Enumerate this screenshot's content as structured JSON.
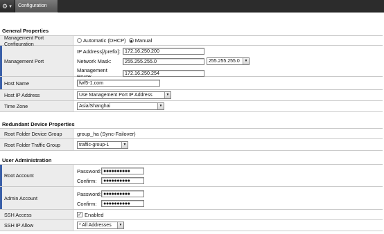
{
  "toolbar": {
    "config_tab_label": "Configuration"
  },
  "general": {
    "title": "General Properties",
    "mgmt_port_config": {
      "label": "Management Port Configuration",
      "auto_label": "Automatic (DHCP)",
      "manual_label": "Manual",
      "selected": "Manual"
    },
    "mgmt_port": {
      "label": "Management Port",
      "ip_label": "IP Address[/prefix]:",
      "ip_value": "172.16.250.200",
      "mask_label": "Network Mask:",
      "mask_value": "255.255.255.0",
      "mask_select": "255.255.255.0",
      "route_label": "Management Route:",
      "route_value": "172.16.250.254"
    },
    "host_name": {
      "label": "Host Name",
      "value": "fwf5-1.com"
    },
    "host_ip": {
      "label": "Host IP Address",
      "value": "Use Management Port IP Address"
    },
    "time_zone": {
      "label": "Time Zone",
      "value": "Asia/Shanghai"
    }
  },
  "redundant": {
    "title": "Redundant Device Properties",
    "device_group": {
      "label": "Root Folder Device Group",
      "value": "group_ha (Sync-Failover)"
    },
    "traffic_group": {
      "label": "Root Folder Traffic Group",
      "value": "traffic-group-1"
    }
  },
  "users": {
    "title": "User Administration",
    "root": {
      "label": "Root Account",
      "password_label": "Password:",
      "password_value": "●●●●●●●●●●",
      "confirm_label": "Confirm:",
      "confirm_value": "●●●●●●●●●●"
    },
    "admin": {
      "label": "Admin Account",
      "password_label": "Password:",
      "password_value": "●●●●●●●●●●",
      "confirm_label": "Confirm:",
      "confirm_value": "●●●●●●●●●●"
    },
    "ssh_access": {
      "label": "SSH Access",
      "value": "Enabled",
      "checked": true
    },
    "ssh_ip_allow": {
      "label": "SSH IP Allow",
      "value": "* All Addresses"
    }
  }
}
